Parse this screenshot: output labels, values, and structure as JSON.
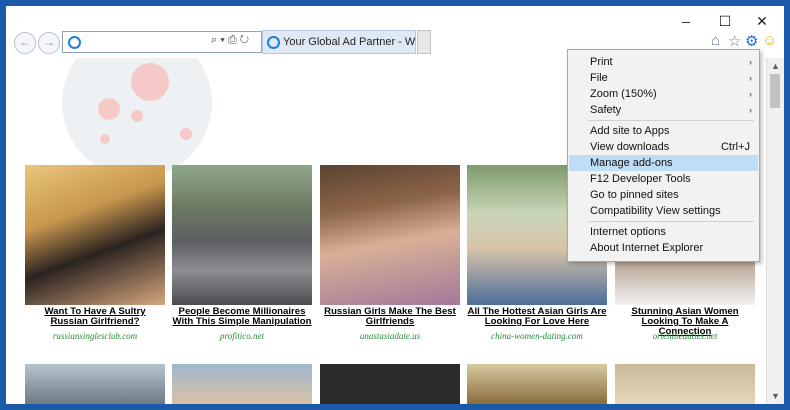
{
  "window": {
    "controls": {
      "minimize": "–",
      "maximize": "☐",
      "close": "✕"
    }
  },
  "nav": {
    "back": "←",
    "forward": "→",
    "address_tools": "⌕ ▾ ⎙ ↻"
  },
  "tab": {
    "title": "Your Global Ad Partner - We...",
    "close": "✕"
  },
  "toolbar": {
    "home": "⌂",
    "favorites": "☆",
    "tools": "⚙",
    "smiley": "☺"
  },
  "ads": [
    {
      "title": "Want To Have A Sultry Russian Girlfriend?",
      "domain": "russiansinglesclub.com"
    },
    {
      "title": "People Become Millionaires With This Simple Manipulation",
      "domain": "profitico.net"
    },
    {
      "title": "Russian Girls Make The Best Girlfriends",
      "domain": "anastasiadate.us"
    },
    {
      "title": "All The Hottest Asian Girls Are Looking For Love Here",
      "domain": "china-women-dating.com"
    },
    {
      "title": "Stunning Asian Women Looking To Make A Connection",
      "domain": "orientbeauties.net"
    }
  ],
  "menu": {
    "items": [
      {
        "label": "Print",
        "submenu": true,
        "shortcut": ""
      },
      {
        "label": "File",
        "submenu": true,
        "shortcut": ""
      },
      {
        "label": "Zoom (150%)",
        "submenu": true,
        "shortcut": ""
      },
      {
        "label": "Safety",
        "submenu": true,
        "shortcut": ""
      },
      {
        "label": "Add site to Apps",
        "submenu": false,
        "shortcut": ""
      },
      {
        "label": "View downloads",
        "submenu": false,
        "shortcut": "Ctrl+J"
      },
      {
        "label": "Manage add-ons",
        "submenu": false,
        "shortcut": "",
        "highlighted": true
      },
      {
        "label": "F12 Developer Tools",
        "submenu": false,
        "shortcut": ""
      },
      {
        "label": "Go to pinned sites",
        "submenu": false,
        "shortcut": ""
      },
      {
        "label": "Compatibility View settings",
        "submenu": false,
        "shortcut": ""
      },
      {
        "label": "Internet options",
        "submenu": false,
        "shortcut": ""
      },
      {
        "label": "About Internet Explorer",
        "submenu": false,
        "shortcut": ""
      }
    ],
    "arrow": "›"
  },
  "scrollbar": {
    "up": "▲",
    "down": "▼"
  },
  "colors": {
    "accent": "#1a5aa8",
    "highlight": "#bfddf5",
    "domain_green": "#2b8a3e"
  }
}
